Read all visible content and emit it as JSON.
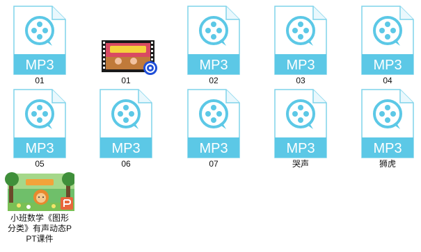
{
  "colors": {
    "mp3_band": "#5cc8e6",
    "mp3_outline": "#7fd3ea",
    "mp3_icon": "#5cc8e6"
  },
  "files": [
    {
      "name": "01",
      "type": "audio",
      "badge": "MP3",
      "icon": "play-circle-icon"
    },
    {
      "name": "01",
      "type": "video",
      "badge": "",
      "icon": "video-thumbnail"
    },
    {
      "name": "02",
      "type": "audio",
      "badge": "MP3",
      "icon": "play-circle-icon"
    },
    {
      "name": "03",
      "type": "audio",
      "badge": "MP3",
      "icon": "play-circle-icon"
    },
    {
      "name": "04",
      "type": "audio",
      "badge": "MP3",
      "icon": "play-circle-icon"
    },
    {
      "name": "05",
      "type": "audio",
      "badge": "MP3",
      "icon": "play-circle-icon"
    },
    {
      "name": "06",
      "type": "audio",
      "badge": "MP3",
      "icon": "play-circle-icon"
    },
    {
      "name": "07",
      "type": "audio",
      "badge": "MP3",
      "icon": "play-circle-icon"
    },
    {
      "name": "哭声",
      "type": "audio",
      "badge": "MP3",
      "icon": "play-circle-icon"
    },
    {
      "name": "狮虎",
      "type": "audio",
      "badge": "MP3",
      "icon": "play-circle-icon"
    },
    {
      "name": "小班数学《图形分类》有声动态PPT课件",
      "type": "ppt",
      "badge": "",
      "icon": "presentation-thumbnail"
    }
  ]
}
